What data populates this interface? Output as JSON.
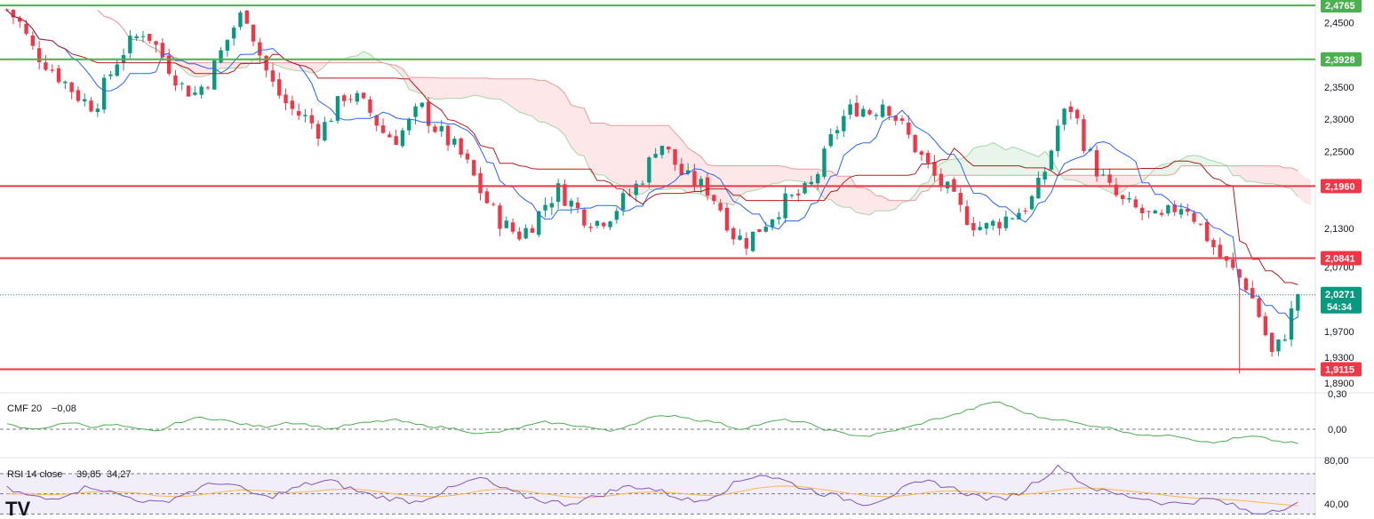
{
  "chart_data": {
    "type": "candlestick",
    "main_panel": {
      "ylim": [
        1.875,
        2.485
      ],
      "y_ticks": [
        "2,4500",
        "2,3500",
        "2,3000",
        "2,2500",
        "2,1300",
        "2,0700",
        "1,9700",
        "1,9300",
        "1,8900"
      ],
      "y_tick_values": [
        2.45,
        2.35,
        2.3,
        2.25,
        2.13,
        2.07,
        1.97,
        1.93,
        1.89
      ],
      "levels": [
        {
          "value": 2.4765,
          "label": "2,4765",
          "color": "#4caf50"
        },
        {
          "value": 2.3928,
          "label": "2,3928",
          "color": "#4caf50"
        },
        {
          "value": 2.196,
          "label": "2,1960",
          "color": "#f23645"
        },
        {
          "value": 2.0841,
          "label": "2,0841",
          "color": "#f23645"
        },
        {
          "value": 1.9115,
          "label": "1,9115",
          "color": "#f23645"
        }
      ],
      "current_price": {
        "value": 2.0271,
        "label": "2,0271",
        "countdown": "54:34",
        "color": "#089981"
      },
      "series": [
        {
          "name": "price",
          "kind": "candles",
          "up_color": "#089981",
          "down_color": "#f23645"
        },
        {
          "name": "tenkan",
          "kind": "line",
          "color": "#2962ff"
        },
        {
          "name": "kijun",
          "kind": "line",
          "color": "#b71c1c"
        },
        {
          "name": "kumo_bull",
          "kind": "cloud",
          "color": "#4caf50"
        },
        {
          "name": "kumo_bear",
          "kind": "cloud",
          "color": "#f23645"
        }
      ],
      "anchors": [
        2.47,
        2.45,
        2.41,
        2.39,
        2.37,
        2.35,
        2.33,
        2.32,
        2.36,
        2.4,
        2.42,
        2.44,
        2.41,
        2.38,
        2.35,
        2.34,
        2.36,
        2.4,
        2.44,
        2.47,
        2.41,
        2.36,
        2.33,
        2.31,
        2.3,
        2.28,
        2.31,
        2.34,
        2.33,
        2.31,
        2.28,
        2.27,
        2.29,
        2.32,
        2.29,
        2.27,
        2.25,
        2.22,
        2.18,
        2.15,
        2.13,
        2.12,
        2.14,
        2.17,
        2.19,
        2.17,
        2.15,
        2.14,
        2.15,
        2.17,
        2.19,
        2.22,
        2.27,
        2.24,
        2.21,
        2.2,
        2.19,
        2.16,
        2.12,
        2.11,
        2.13,
        2.15,
        2.17,
        2.18,
        2.19,
        2.23,
        2.28,
        2.31,
        2.32,
        2.31,
        2.33,
        2.3,
        2.27,
        2.24,
        2.21,
        2.19,
        2.16,
        2.14,
        2.13,
        2.14,
        2.15,
        2.16,
        2.18,
        2.23,
        2.3,
        2.32,
        2.26,
        2.22,
        2.19,
        2.17,
        2.16,
        2.15,
        2.14,
        2.16,
        2.17,
        2.14,
        2.11,
        2.08,
        2.06,
        2.04,
        1.99,
        1.93,
        1.97,
        2.03
      ],
      "candle_count": 200
    },
    "cmf": {
      "title": "CMF 20",
      "value": "−0,08",
      "value_color": "#4caf50",
      "ylim": [
        -0.12,
        0.15
      ],
      "y_ticks": [
        "0,30",
        "0,00"
      ],
      "zero_label": "0,00",
      "line_color": "#4caf50",
      "anchors": [
        0.02,
        0.0,
        0.01,
        0.03,
        0.01,
        0.02,
        0.0,
        -0.01,
        0.03,
        0.05,
        0.04,
        0.02,
        0.01,
        0.03,
        0.02,
        0.0,
        0.02,
        0.03,
        0.04,
        0.02,
        0.01,
        0.0,
        -0.02,
        -0.01,
        0.01,
        0.03,
        0.02,
        0.01,
        -0.01,
        0.02,
        0.05,
        0.06,
        0.04,
        0.03,
        0.0,
        0.02,
        0.04,
        0.03,
        0.0,
        -0.02,
        -0.03,
        -0.01,
        0.01,
        0.04,
        0.06,
        0.09,
        0.12,
        0.08,
        0.05,
        0.04,
        0.02,
        0.01,
        -0.01,
        -0.03,
        -0.02,
        -0.04,
        -0.06,
        -0.04,
        -0.03,
        -0.05,
        -0.06
      ],
      "max_label": "0,30"
    },
    "rsi": {
      "title": "RSI 14 close",
      "value": "39,85",
      "value_color": "#7e57c2",
      "ma_value": "34,27",
      "ma_color": "#ffb74d",
      "ylim": [
        25,
        85
      ],
      "y_ticks": [
        "80,00",
        "40,00"
      ],
      "bands": [
        70,
        30
      ],
      "midline": 50,
      "rsi_anchors": [
        55,
        48,
        44,
        52,
        58,
        50,
        45,
        40,
        48,
        56,
        62,
        54,
        46,
        52,
        60,
        63,
        55,
        48,
        45,
        42,
        50,
        58,
        66,
        55,
        48,
        43,
        40,
        45,
        52,
        58,
        55,
        48,
        42,
        50,
        62,
        70,
        64,
        56,
        50,
        45,
        40,
        48,
        58,
        62,
        55,
        48,
        44,
        50,
        65,
        78,
        60,
        52,
        48,
        45,
        40,
        42,
        45,
        38,
        30,
        35,
        40
      ],
      "ma_anchors": [
        50,
        50,
        49,
        50,
        52,
        52,
        51,
        48,
        47,
        49,
        52,
        54,
        53,
        51,
        52,
        54,
        55,
        53,
        50,
        48,
        47,
        49,
        53,
        55,
        53,
        50,
        47,
        46,
        48,
        51,
        52,
        51,
        49,
        48,
        52,
        56,
        58,
        57,
        54,
        51,
        48,
        47,
        49,
        52,
        53,
        52,
        50,
        49,
        51,
        54,
        56,
        55,
        53,
        51,
        48,
        46,
        45,
        44,
        42,
        40,
        38
      ]
    }
  }
}
